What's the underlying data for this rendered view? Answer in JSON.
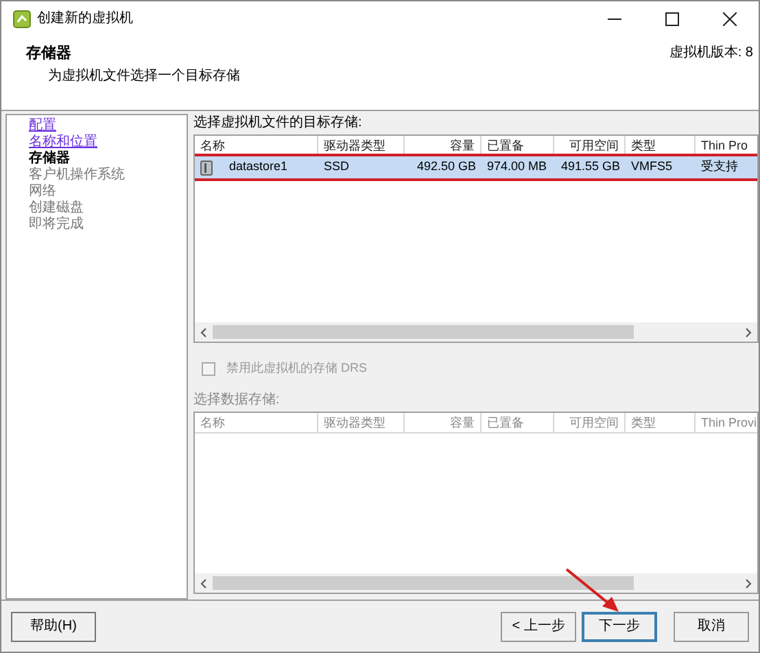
{
  "window": {
    "title": "创建新的虚拟机"
  },
  "header": {
    "title": "存储器",
    "subtitle": "为虚拟机文件选择一个目标存储",
    "version": "虚拟机版本: 8"
  },
  "steps": [
    {
      "label": "配置",
      "kind": "done"
    },
    {
      "label": "名称和位置",
      "kind": "done"
    },
    {
      "label": "存储器",
      "kind": "current"
    },
    {
      "label": "客户机操作系统",
      "kind": "pending"
    },
    {
      "label": "网络",
      "kind": "pending"
    },
    {
      "label": "创建磁盘",
      "kind": "pending"
    },
    {
      "label": "即将完成",
      "kind": "pending"
    }
  ],
  "target_table": {
    "caption": "选择虚拟机文件的目标存储:",
    "columns": [
      "名称",
      "驱动器类型",
      "容量",
      "已置备",
      "可用空间",
      "类型",
      "Thin Pro"
    ],
    "rows": [
      {
        "cells": [
          "datastore1",
          "SSD",
          "492.50 GB",
          "974.00 MB",
          "491.55 GB",
          "VMFS5",
          "受支持"
        ],
        "selected": true
      }
    ]
  },
  "sdrs_checkbox": {
    "label": "禁用此虚拟机的存储 DRS",
    "checked": false,
    "disabled": true
  },
  "datastore_table": {
    "caption": "选择数据存储:",
    "columns": [
      "名称",
      "驱动器类型",
      "容量",
      "已置备",
      "可用空间",
      "类型",
      "Thin Provi"
    ]
  },
  "buttons": {
    "help": "帮助(H)",
    "back": "< 上一步",
    "next": "下一步",
    "cancel": "取消"
  }
}
